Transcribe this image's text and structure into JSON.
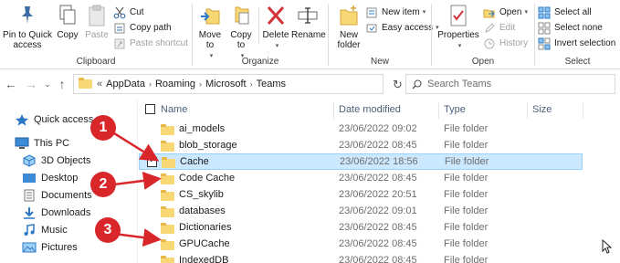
{
  "ribbon": {
    "clipboard": {
      "label": "Clipboard",
      "pin": "Pin to Quick access",
      "copy": "Copy",
      "paste": "Paste",
      "cut": "Cut",
      "copy_path": "Copy path",
      "paste_shortcut": "Paste shortcut"
    },
    "organize": {
      "label": "Organize",
      "move_to": "Move to",
      "copy_to": "Copy to",
      "delete": "Delete",
      "rename": "Rename"
    },
    "new": {
      "label": "New",
      "new_folder": "New folder",
      "new_item": "New item",
      "easy_access": "Easy access"
    },
    "open": {
      "label": "Open",
      "properties": "Properties",
      "open": "Open",
      "edit": "Edit",
      "history": "History"
    },
    "select": {
      "label": "Select",
      "select_all": "Select all",
      "select_none": "Select none",
      "invert": "Invert selection"
    }
  },
  "address": {
    "overflow": "«",
    "crumbs": [
      "AppData",
      "Roaming",
      "Microsoft",
      "Teams"
    ]
  },
  "search": {
    "placeholder": "Search Teams"
  },
  "nav": {
    "items": [
      {
        "label": "Quick access",
        "icon": "star-icon"
      },
      {
        "label": "This PC",
        "icon": "pc-icon"
      },
      {
        "label": "3D Objects",
        "icon": "cube-icon"
      },
      {
        "label": "Desktop",
        "icon": "desktop-icon"
      },
      {
        "label": "Documents",
        "icon": "documents-icon"
      },
      {
        "label": "Downloads",
        "icon": "download-icon"
      },
      {
        "label": "Music",
        "icon": "music-icon"
      },
      {
        "label": "Pictures",
        "icon": "pictures-icon"
      }
    ]
  },
  "list": {
    "columns": [
      "Name",
      "Date modified",
      "Type",
      "Size"
    ],
    "rows": [
      {
        "name": "ai_models",
        "date": "23/06/2022 09:02",
        "type": "File folder",
        "selected": false
      },
      {
        "name": "blob_storage",
        "date": "23/06/2022 08:45",
        "type": "File folder",
        "selected": false
      },
      {
        "name": "Cache",
        "date": "23/06/2022 18:56",
        "type": "File folder",
        "selected": true
      },
      {
        "name": "Code Cache",
        "date": "23/06/2022 08:45",
        "type": "File folder",
        "selected": false
      },
      {
        "name": "CS_skylib",
        "date": "23/06/2022 20:51",
        "type": "File folder",
        "selected": false
      },
      {
        "name": "databases",
        "date": "23/06/2022 09:01",
        "type": "File folder",
        "selected": false
      },
      {
        "name": "Dictionaries",
        "date": "23/06/2022 08:45",
        "type": "File folder",
        "selected": false
      },
      {
        "name": "GPUCache",
        "date": "23/06/2022 08:45",
        "type": "File folder",
        "selected": false
      },
      {
        "name": "IndexedDB",
        "date": "23/06/2022 08:45",
        "type": "File folder",
        "selected": false
      }
    ]
  },
  "annotations": {
    "badges": [
      "1",
      "2",
      "3"
    ],
    "color": "#d9262b"
  },
  "colors": {
    "selection_bg": "#cce8ff",
    "selection_border": "#99d1ff",
    "folder": "#f8d775",
    "header_text": "#4c607a"
  }
}
